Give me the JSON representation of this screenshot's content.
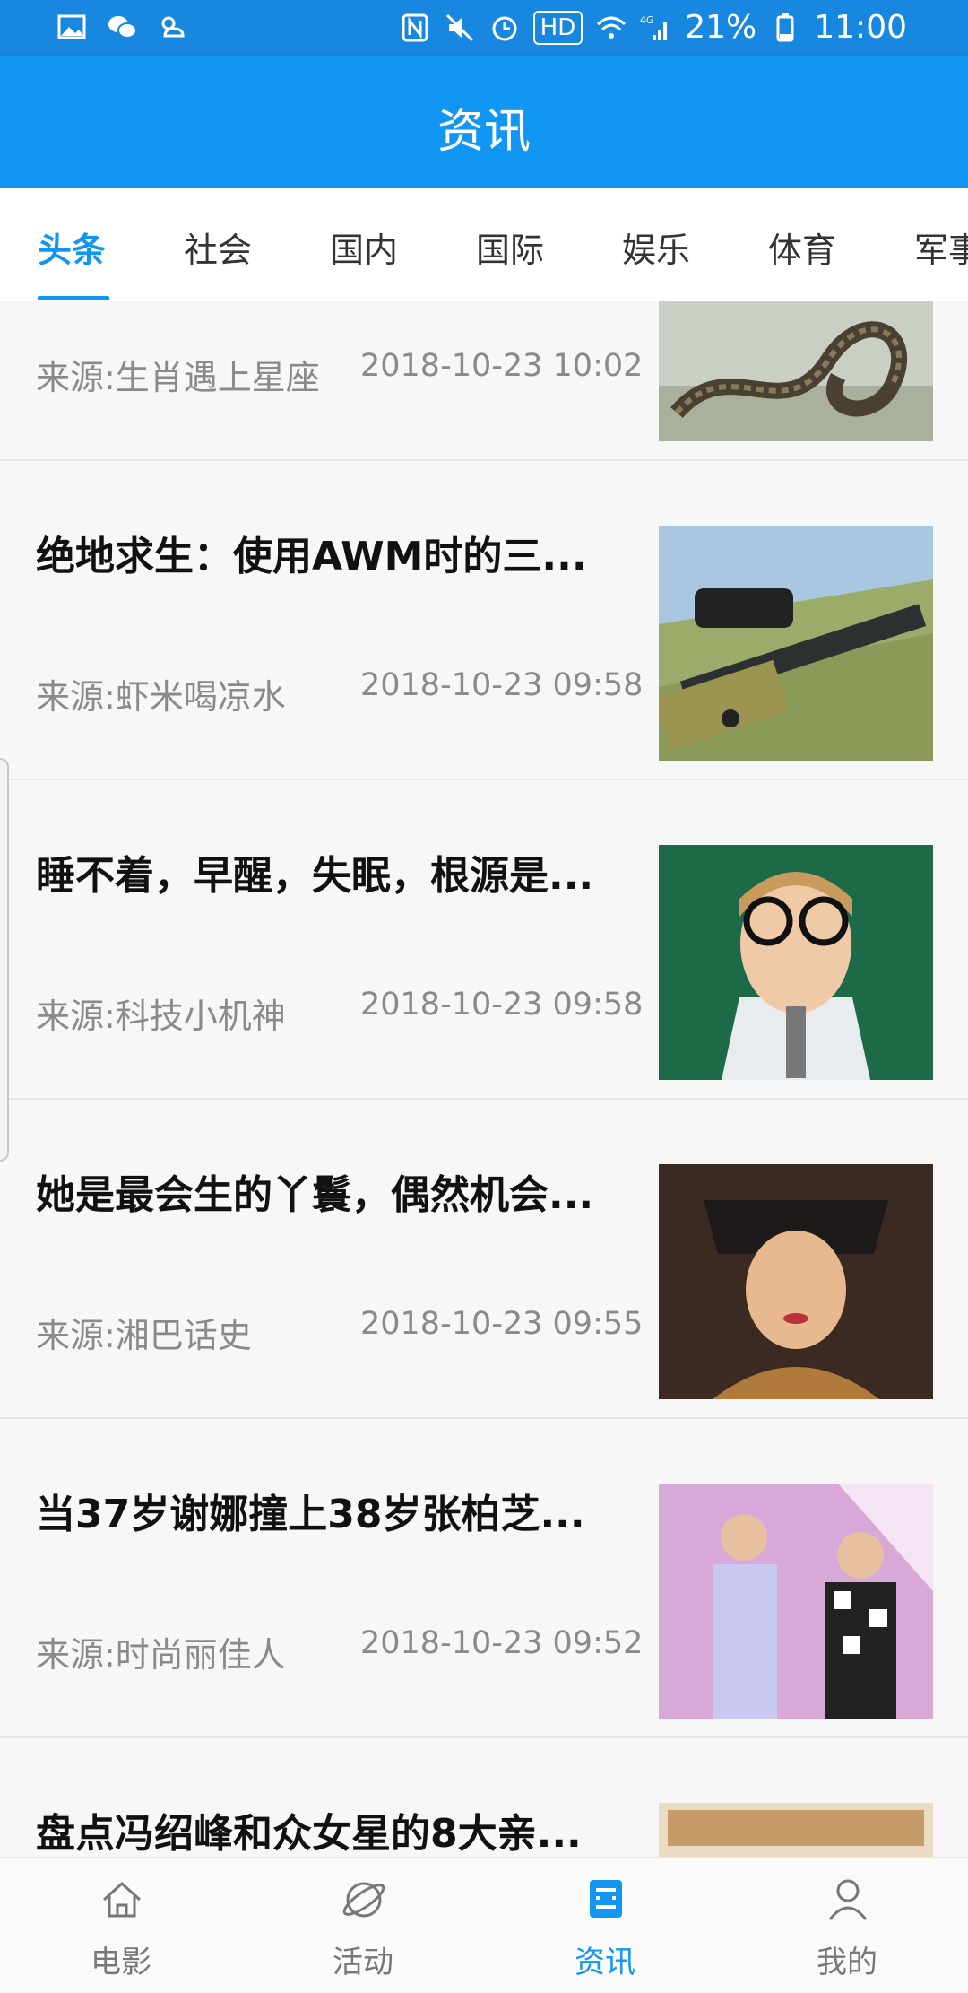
{
  "status_bar": {
    "battery": "21%",
    "time": "11:00",
    "hd": "HD",
    "network": "4G",
    "left_icons": [
      "gallery-icon",
      "wechat-icon",
      "weather-icon"
    ],
    "right_icons": [
      "nfc-icon",
      "mute-icon",
      "alarm-icon",
      "hd-icon",
      "wifi-icon",
      "signal-icon",
      "battery-icon"
    ]
  },
  "header": {
    "title": "资讯"
  },
  "tabs": [
    {
      "label": "头条",
      "active": true
    },
    {
      "label": "社会",
      "active": false
    },
    {
      "label": "国内",
      "active": false
    },
    {
      "label": "国际",
      "active": false
    },
    {
      "label": "娱乐",
      "active": false
    },
    {
      "label": "体育",
      "active": false
    },
    {
      "label": "军事",
      "active": false
    }
  ],
  "feed": {
    "items": [
      {
        "title": "",
        "source": "来源:生肖遇上星座",
        "time": "2018-10-23 10:02",
        "thumb": "snake-image"
      },
      {
        "title": "绝地求生：使用AWM时的三...",
        "source": "来源:虾米喝凉水",
        "time": "2018-10-23 09:58",
        "thumb": "sniper-rifle-image"
      },
      {
        "title": "睡不着，早醒，失眠，根源是...",
        "source": "来源:科技小机神",
        "time": "2018-10-23 09:58",
        "thumb": "girl-glasses-image"
      },
      {
        "title": "她是最会生的丫鬟，偶然机会...",
        "source": "来源:湘巴话史",
        "time": "2018-10-23 09:55",
        "thumb": "qing-drama-actress-image"
      },
      {
        "title": "当37岁谢娜撞上38岁张柏芝...",
        "source": "来源:时尚丽佳人",
        "time": "2018-10-23 09:52",
        "thumb": "stage-performers-image"
      },
      {
        "title": "盘点冯绍峰和众女星的8大亲...",
        "source": "",
        "time": "",
        "thumb": "magazine-image"
      }
    ]
  },
  "bottom_nav": [
    {
      "label": "电影",
      "icon": "home-icon",
      "active": false
    },
    {
      "label": "活动",
      "icon": "planet-icon",
      "active": false
    },
    {
      "label": "资讯",
      "icon": "news-icon",
      "active": true
    },
    {
      "label": "我的",
      "icon": "user-icon",
      "active": false
    }
  ],
  "colors": {
    "primary": "#1296f3",
    "status_bar": "#1787e0",
    "text": "#111111",
    "meta_text": "#8a8a8a"
  }
}
